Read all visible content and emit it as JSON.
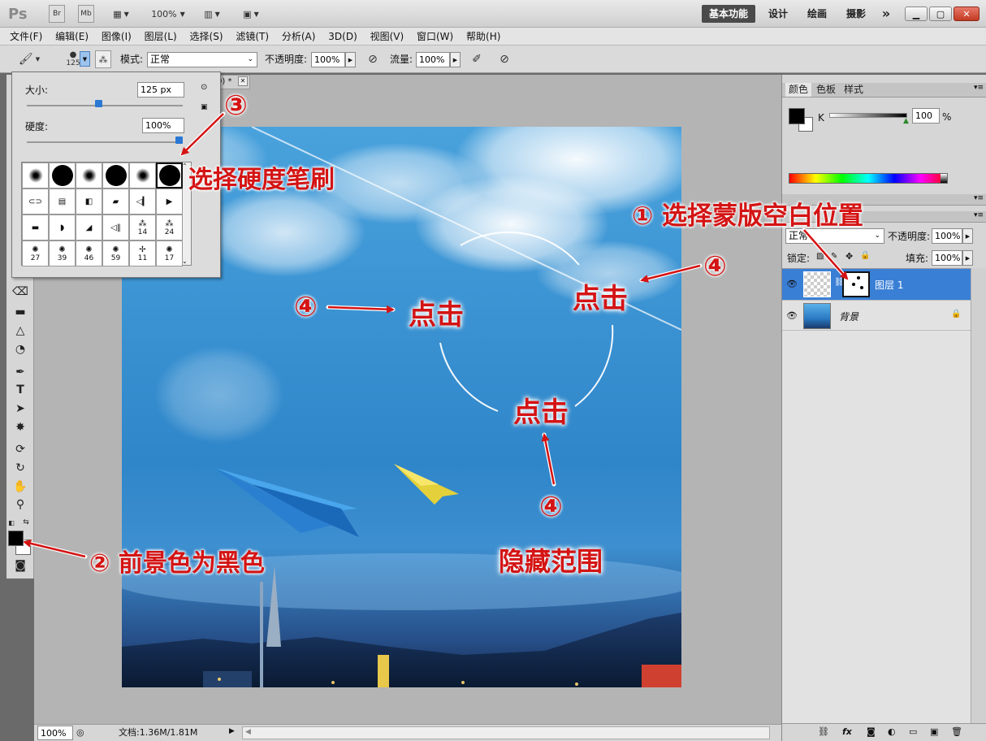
{
  "app": {
    "logo": "Ps"
  },
  "title_toolbar": {
    "br_label": "Br",
    "mb_label": "Mb",
    "zoom": "100%",
    "workspaces": [
      "基本功能",
      "设计",
      "绘画",
      "摄影"
    ],
    "more_label": "»"
  },
  "menu": [
    "文件(F)",
    "编辑(E)",
    "图像(I)",
    "图层(L)",
    "选择(S)",
    "滤镜(T)",
    "分析(A)",
    "3D(D)",
    "视图(V)",
    "窗口(W)",
    "帮助(H)"
  ],
  "options": {
    "brush_size_label": "125",
    "mode_label": "模式:",
    "mode_value": "正常",
    "opacity_label": "不透明度:",
    "opacity_value": "100%",
    "flow_label": "流量:",
    "flow_value": "100%"
  },
  "brush_panel": {
    "size_label": "大小:",
    "size_value": "125 px",
    "hardness_label": "硬度:",
    "hardness_value": "100%",
    "size_slider": 0.46,
    "hardness_slider": 1.0,
    "presets_row4": [
      "27",
      "39",
      "46",
      "59",
      "11",
      "17"
    ],
    "presets_row3": [
      "",
      "",
      "",
      "",
      "14",
      "24"
    ]
  },
  "doc_tab": {
    "title": "0) *"
  },
  "status": {
    "zoom": "100%",
    "doc_info": "文档:1.36M/1.81M"
  },
  "color_panel": {
    "tabs": [
      "颜色",
      "色板",
      "样式"
    ],
    "channel": "K",
    "value": "100",
    "unit": "%"
  },
  "layers_panel": {
    "blend_mode": "正常",
    "opacity_label": "不透明度:",
    "opacity_value": "100%",
    "lock_label": "锁定:",
    "fill_label": "填充:",
    "fill_value": "100%",
    "layers": [
      {
        "name": "图层 1",
        "selected": true
      },
      {
        "name": "背景",
        "selected": false
      }
    ]
  },
  "annotations": {
    "a1": "① 选择蒙版空白位置",
    "a2": "② 前景色为黑色",
    "a3_num": "③",
    "a3": "选择硬度笔刷",
    "a4_num": "④",
    "click": "点击",
    "hide_range": "隐藏范围"
  },
  "colors": {
    "accent": "#d41414",
    "selected_layer": "#3a7fd6",
    "workspace_active": "#4a4a4a"
  }
}
